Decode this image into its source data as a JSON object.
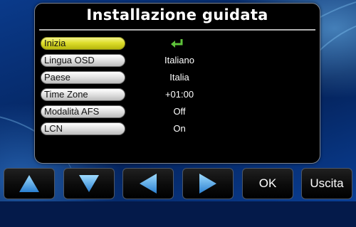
{
  "dialog": {
    "title": "Installazione guidata"
  },
  "menu": [
    {
      "label": "Inizia",
      "value": "",
      "icon": "enter-icon",
      "selected": true
    },
    {
      "label": "Lingua OSD",
      "value": "Italiano",
      "selected": false
    },
    {
      "label": "Paese",
      "value": "Italia",
      "selected": false
    },
    {
      "label": "Time Zone",
      "value": "+01:00",
      "selected": false
    },
    {
      "label": "Modalità AFS",
      "value": "Off",
      "selected": false
    },
    {
      "label": "LCN",
      "value": "On",
      "selected": false
    }
  ],
  "toolbar": {
    "up": {
      "icon": "arrow-up-icon"
    },
    "down": {
      "icon": "arrow-down-icon"
    },
    "left": {
      "icon": "arrow-left-icon"
    },
    "right": {
      "icon": "arrow-right-icon"
    },
    "ok_label": "OK",
    "exit_label": "Uscita"
  },
  "colors": {
    "selected_item": "#dede2c",
    "enter_icon": "#5ec23a",
    "arrow": "#5fb4f0",
    "background": "#062a6a"
  }
}
